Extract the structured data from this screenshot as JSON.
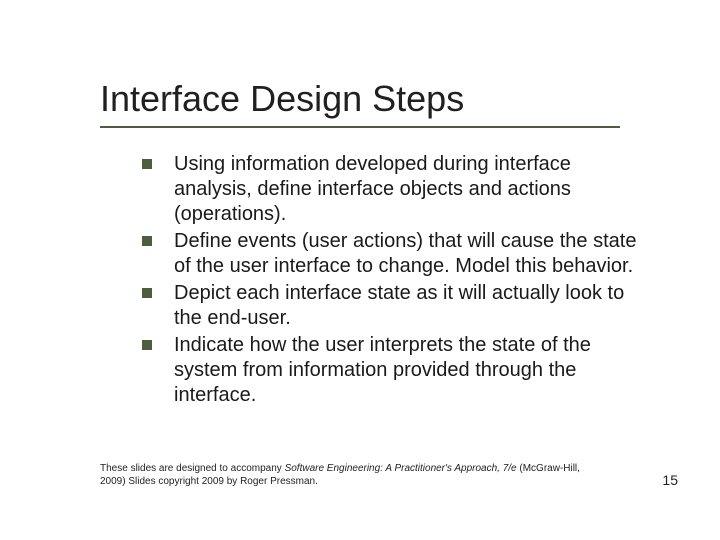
{
  "slide": {
    "title": "Interface Design Steps",
    "bullets": [
      "Using information developed during interface analysis, define interface objects and actions (operations).",
      "Define events (user actions) that will cause the state of the user interface to change. Model this behavior.",
      "Depict each interface state as it will actually look to the end-user.",
      "Indicate how the user interprets the state of the system from information provided through the interface."
    ],
    "footer_prefix": "These slides are designed to accompany ",
    "footer_book": "Software Engineering: A Practitioner's Approach, 7/e",
    "footer_suffix": " (McGraw-Hill, 2009) Slides copyright 2009 by Roger Pressman.",
    "page_number": "15"
  }
}
